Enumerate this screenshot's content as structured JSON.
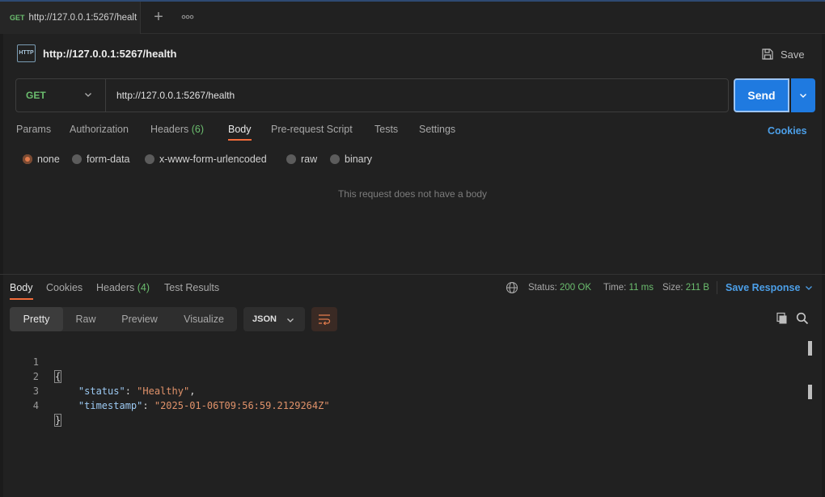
{
  "tab": {
    "method": "GET",
    "title": "http://127.0.0.1:5267/healt"
  },
  "tabstrip": {
    "add_icon": "plus-icon",
    "more_icon": "more-icon"
  },
  "request": {
    "name": "http://127.0.0.1:5267/health",
    "icon_label": "HTTP",
    "save_label": "Save",
    "method": "GET",
    "url": "http://127.0.0.1:5267/health",
    "send_label": "Send"
  },
  "request_tabs": {
    "params": "Params",
    "authorization": "Authorization",
    "headers": "Headers",
    "headers_count": "(6)",
    "body": "Body",
    "prerequest": "Pre-request Script",
    "tests": "Tests",
    "settings": "Settings",
    "cookies": "Cookies"
  },
  "body_types": {
    "selected": "none",
    "options": [
      "none",
      "form-data",
      "x-www-form-urlencoded",
      "raw",
      "binary"
    ]
  },
  "no_body_message": "This request does not have a body",
  "response": {
    "tabs": {
      "body": "Body",
      "cookies": "Cookies",
      "headers": "Headers",
      "headers_count": "(4)",
      "test_results": "Test Results"
    },
    "status_label": "Status:",
    "status_value": "200 OK",
    "time_label": "Time:",
    "time_value": "11 ms",
    "size_label": "Size:",
    "size_value": "211 B",
    "save_response": "Save Response",
    "views": [
      "Pretty",
      "Raw",
      "Preview",
      "Visualize"
    ],
    "active_view": "Pretty",
    "format": "JSON",
    "code": {
      "line_numbers": [
        "1",
        "2",
        "3",
        "4"
      ],
      "open_brace": "{",
      "close_brace": "}",
      "status_key": "\"status\"",
      "status_value": "\"Healthy\"",
      "timestamp_key": "\"timestamp\"",
      "timestamp_value": "\"2025-01-06T09:56:59.2129264Z\""
    }
  },
  "colors": {
    "accent_orange": "#f26b3a",
    "send_blue": "#1f7ae0",
    "method_green": "#6bbd6e",
    "link_blue": "#4c9fe8"
  }
}
